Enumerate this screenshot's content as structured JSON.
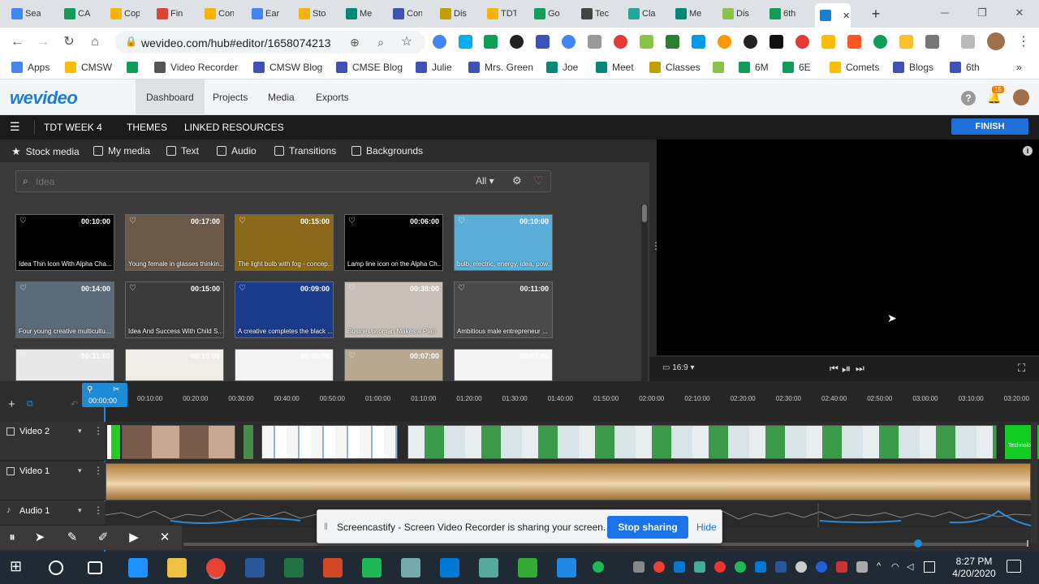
{
  "browser": {
    "tabs": [
      {
        "label": "Sea",
        "color": "#4285f4"
      },
      {
        "label": "CA",
        "color": "#0f9d58"
      },
      {
        "label": "Cop",
        "color": "#f4b400"
      },
      {
        "label": "Fin",
        "color": "#db4437"
      },
      {
        "label": "Con",
        "color": "#f4b400"
      },
      {
        "label": "Ear",
        "color": "#4285f4"
      },
      {
        "label": "Sto",
        "color": "#f4b400"
      },
      {
        "label": "Me",
        "color": "#00897b"
      },
      {
        "label": "Con",
        "color": "#3f51b5"
      },
      {
        "label": "Dis",
        "color": "#c0a000"
      },
      {
        "label": "TDT",
        "color": "#f4b400"
      },
      {
        "label": "Go",
        "color": "#0f9d58"
      },
      {
        "label": "Tec",
        "color": "#444"
      },
      {
        "label": "Cla",
        "color": "#26a69a"
      },
      {
        "label": "Me",
        "color": "#00897b"
      },
      {
        "label": "Dis",
        "color": "#8bc34a"
      },
      {
        "label": "6th",
        "color": "#0f9d58"
      },
      {
        "label": "",
        "color": "#1a7fd1"
      }
    ],
    "new_tab_symbol": "+",
    "url": "wevideo.com/hub#editor/1658074213",
    "bookmarks": [
      {
        "label": "Apps",
        "color": "#4285f4"
      },
      {
        "label": "CMSW",
        "color": "#fbbc05"
      },
      {
        "label": "",
        "color": "#0f9d58"
      },
      {
        "label": "Video Recorder",
        "color": "#555"
      },
      {
        "label": "CMSW Blog",
        "color": "#3f51b5"
      },
      {
        "label": "CMSE Blog",
        "color": "#3f51b5"
      },
      {
        "label": "Julie",
        "color": "#3f51b5"
      },
      {
        "label": "Mrs. Green",
        "color": "#3f51b5"
      },
      {
        "label": "Joe",
        "color": "#00897b"
      },
      {
        "label": "Meet",
        "color": "#00897b"
      },
      {
        "label": "Classes",
        "color": "#c0a000"
      },
      {
        "label": "",
        "color": "#8bc34a"
      },
      {
        "label": "6M",
        "color": "#0f9d58"
      },
      {
        "label": "6E",
        "color": "#0f9d58"
      },
      {
        "label": "Comets",
        "color": "#fbbc05"
      },
      {
        "label": "Blogs",
        "color": "#3f51b5"
      },
      {
        "label": "6th",
        "color": "#3f51b5"
      }
    ],
    "more_symbol": "»"
  },
  "wevideo": {
    "logo": "wevideo",
    "nav": [
      "Dashboard",
      "Projects",
      "Media",
      "Exports"
    ],
    "active_nav": "Dashboard",
    "notifications_count": "15"
  },
  "editor": {
    "project_title": "TDT WEEK 4",
    "themes": "THEMES",
    "linked_resources": "LINKED RESOURCES",
    "finish": "FINISH"
  },
  "media": {
    "tabs": [
      "Stock media",
      "My media",
      "Text",
      "Audio",
      "Transitions",
      "Backgrounds"
    ],
    "search_placeholder": "Idea",
    "filter_value": "All",
    "thumbs": [
      {
        "duration": "00:10:00",
        "title": "Idea Thin Icon With Alpha Cha...",
        "bg": "#000"
      },
      {
        "duration": "00:17:00",
        "title": "Young female in glasses thinkin...",
        "bg": "#6b5a4a"
      },
      {
        "duration": "00:15:00",
        "title": "The light bulb with fog - concep...",
        "bg": "#8a6a1a"
      },
      {
        "duration": "00:06:00",
        "title": "Lamp line icon on the Alpha Ch...",
        "bg": "#000"
      },
      {
        "duration": "00:10:00",
        "title": "bulb, electric, energy, idea, pow...",
        "bg": "#5aaed8"
      },
      {
        "duration": "00:14:00",
        "title": "Four young creative multicultu...",
        "bg": "#5a6a78"
      },
      {
        "duration": "00:15:00",
        "title": "Idea And Success With Child S...",
        "bg": "#3a3a3a"
      },
      {
        "duration": "00:09:00",
        "title": "A creative completes the black ...",
        "bg": "#1a3a8a"
      },
      {
        "duration": "00:38:00",
        "title": "Businesswoman Makes a Plan",
        "bg": "#c8c0b8"
      },
      {
        "duration": "00:11:00",
        "title": "Ambitious male entrepreneur ...",
        "bg": "#4a4a4a"
      },
      {
        "duration": "00:31:00",
        "title": "",
        "bg": "#e8e8e8"
      },
      {
        "duration": "00:10:00",
        "title": "",
        "bg": "#f0ece6"
      },
      {
        "duration": "00:05:00",
        "title": "",
        "bg": "#f4f4f4"
      },
      {
        "duration": "00:07:00",
        "title": "",
        "bg": "#b8a890"
      },
      {
        "duration": "00:07:00",
        "title": "",
        "bg": "#f4f4f4"
      }
    ]
  },
  "preview": {
    "aspect": "16:9"
  },
  "timeline": {
    "playhead_time": "00:00:00",
    "ticks": [
      "00:10:00",
      "00:20:00",
      "00:30:00",
      "00:40:00",
      "00:50:00",
      "01:00:00",
      "01:10:00",
      "01:20:00",
      "01:30:00",
      "01:40:00",
      "01:50:00",
      "02:00:00",
      "02:10:00",
      "02:20:00",
      "02:30:00",
      "02:40:00",
      "02:50:00",
      "03:00:00",
      "03:10:00",
      "03:20:00"
    ],
    "tracks": [
      "Video 2",
      "Video 1",
      "Audio 1"
    ],
    "end_clip_label": "Technolog"
  },
  "screencastify": {
    "message": "Screencastify - Screen Video Recorder is sharing your screen.",
    "stop": "Stop sharing",
    "hide": "Hide"
  },
  "taskbar": {
    "time": "8:27 PM",
    "date": "4/20/2020",
    "icons": [
      {
        "name": "windows-start-icon",
        "color": "#fff"
      },
      {
        "name": "cortana-icon",
        "color": "#fff"
      },
      {
        "name": "task-view-icon",
        "color": "#fff"
      },
      {
        "name": "edge-icon",
        "color": "#1e90ff"
      },
      {
        "name": "file-explorer-icon",
        "color": "#f0c040"
      },
      {
        "name": "chrome-icon",
        "color": "#e94235"
      },
      {
        "name": "word-icon",
        "color": "#2b579a"
      },
      {
        "name": "excel-icon",
        "color": "#217346"
      },
      {
        "name": "powerpoint-icon",
        "color": "#d24726"
      },
      {
        "name": "spotify-icon",
        "color": "#1db954"
      },
      {
        "name": "paint-icon",
        "color": "#7aa"
      },
      {
        "name": "outlook-icon",
        "color": "#0078d4"
      },
      {
        "name": "app-icon",
        "color": "#5a9"
      },
      {
        "name": "wps-icon",
        "color": "#3a3"
      },
      {
        "name": "app2-icon",
        "color": "#1e88e5"
      }
    ]
  }
}
